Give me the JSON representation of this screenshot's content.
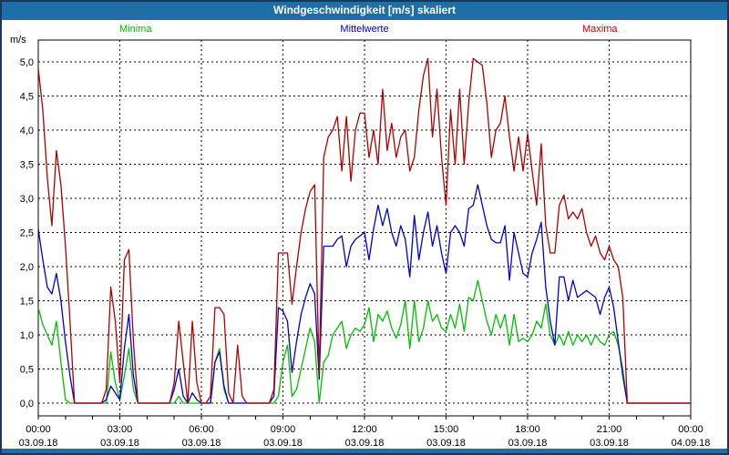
{
  "window": {
    "title": "Windgeschwindigkeit [m/s] skaliert"
  },
  "legend": {
    "minima": {
      "label": "Minima",
      "color": "#00c000"
    },
    "mittelwerte": {
      "label": "Mittelwerte",
      "color": "#0000d0"
    },
    "maxima": {
      "label": "Maxima",
      "color": "#d00000"
    }
  },
  "chart": {
    "unit_label": "m/s"
  },
  "colors": {
    "titlebar_bg": "#1e6fa5",
    "window_border": "#17375e",
    "axis": "#000000",
    "grid": "#000000",
    "background": "#ffffff"
  },
  "chart_data": {
    "type": "line",
    "title": "Windgeschwindigkeit [m/s] skaliert",
    "xlabel": "",
    "ylabel": "m/s",
    "ylim": [
      0,
      5.32
    ],
    "xlim_hours": [
      0,
      24
    ],
    "grid": "dashed",
    "legend_position": "top",
    "sample_step_minutes": 10,
    "y_ticks": [
      {
        "label": "0,0",
        "value": 0.0
      },
      {
        "label": "0,5",
        "value": 0.5
      },
      {
        "label": "1,0",
        "value": 1.0
      },
      {
        "label": "1,5",
        "value": 1.5
      },
      {
        "label": "2,0",
        "value": 2.0
      },
      {
        "label": "2,5",
        "value": 2.5
      },
      {
        "label": "3,0",
        "value": 3.0
      },
      {
        "label": "3,5",
        "value": 3.5
      },
      {
        "label": "4,0",
        "value": 4.0
      },
      {
        "label": "4,5",
        "value": 4.5
      },
      {
        "label": "5,0",
        "value": 5.0
      }
    ],
    "x_ticks": [
      {
        "time": "00:00",
        "date": "03.09.18",
        "hour": 0
      },
      {
        "time": "03:00",
        "date": "03.09.18",
        "hour": 3
      },
      {
        "time": "06:00",
        "date": "03.09.18",
        "hour": 6
      },
      {
        "time": "09:00",
        "date": "03.09.18",
        "hour": 9
      },
      {
        "time": "12:00",
        "date": "03.09.18",
        "hour": 12
      },
      {
        "time": "15:00",
        "date": "03.09.18",
        "hour": 15
      },
      {
        "time": "18:00",
        "date": "03.09.18",
        "hour": 18
      },
      {
        "time": "21:00",
        "date": "03.09.18",
        "hour": 21
      },
      {
        "time": "00:00",
        "date": "04.09.18",
        "hour": 24
      }
    ],
    "x_minor_tick_hours": 1,
    "series": [
      {
        "name": "Minima",
        "color": "#00c000",
        "values": [
          1.4,
          1.15,
          1.0,
          0.85,
          1.2,
          0.6,
          0.05,
          0,
          0,
          0,
          0,
          0,
          0,
          0,
          0,
          0,
          0.75,
          0.3,
          0.05,
          0.4,
          0.8,
          0.2,
          0,
          0,
          0,
          0,
          0,
          0,
          0,
          0,
          0,
          0.1,
          0,
          0,
          0,
          0,
          0,
          0,
          0,
          0.6,
          0.8,
          0.2,
          0,
          0,
          0,
          0,
          0,
          0,
          0,
          0,
          0,
          0,
          0,
          0.1,
          0.6,
          0.85,
          0.1,
          0.2,
          0.5,
          0.8,
          1.1,
          0.9,
          0,
          0.6,
          0.7,
          1.0,
          1.1,
          1.2,
          0.8,
          1.0,
          1.1,
          1.05,
          1.15,
          1.4,
          0.9,
          1.3,
          1.2,
          1.35,
          1.1,
          0.95,
          1.15,
          1.5,
          0.8,
          1.5,
          0.9,
          1.1,
          1.5,
          1.2,
          1.3,
          1.1,
          1.05,
          1.3,
          1.1,
          1.45,
          1.05,
          1.55,
          1.5,
          1.8,
          1.5,
          1.2,
          1.0,
          1.3,
          1.1,
          1.3,
          0.85,
          1.3,
          0.9,
          0.95,
          0.9,
          1.0,
          1.2,
          1.1,
          1.45,
          1.0,
          0.85,
          1.0,
          0.85,
          1.05,
          0.85,
          1.0,
          0.9,
          1.0,
          0.85,
          1.0,
          0.9,
          0.85,
          1.0,
          1.05,
          0.85,
          0.5,
          0,
          0,
          0,
          0,
          0,
          0,
          0,
          0,
          0,
          0,
          0,
          0,
          0,
          0,
          0
        ]
      },
      {
        "name": "Mittelwerte",
        "color": "#0000d0",
        "values": [
          2.55,
          2.1,
          1.7,
          1.6,
          1.9,
          1.5,
          0.9,
          0.4,
          0,
          0,
          0,
          0,
          0,
          0,
          0,
          0.05,
          0.25,
          0.15,
          0.05,
          0.8,
          1.3,
          0.4,
          0,
          0,
          0,
          0,
          0,
          0,
          0,
          0,
          0.2,
          0.5,
          0.1,
          0,
          0.15,
          0.05,
          0,
          0,
          0,
          0.6,
          0.75,
          0.25,
          0,
          0,
          0,
          0,
          0,
          0,
          0,
          0,
          0,
          0,
          0.1,
          1.4,
          1.35,
          1.2,
          0.45,
          0.9,
          1.3,
          1.55,
          1.75,
          1.6,
          0.35,
          2.3,
          2.3,
          2.3,
          2.4,
          2.45,
          2.0,
          2.3,
          2.4,
          2.45,
          2.5,
          2.1,
          2.55,
          2.9,
          2.6,
          2.85,
          2.5,
          2.3,
          2.6,
          2.4,
          1.85,
          2.75,
          2.1,
          2.5,
          2.8,
          2.3,
          2.6,
          2.2,
          1.9,
          2.5,
          2.6,
          2.5,
          2.3,
          2.85,
          2.9,
          3.2,
          2.9,
          2.6,
          2.4,
          2.35,
          2.35,
          2.6,
          1.8,
          2.5,
          2.2,
          1.9,
          1.85,
          2.2,
          2.4,
          2.65,
          1.7,
          1.2,
          0.85,
          1.85,
          1.85,
          1.5,
          1.8,
          1.55,
          1.6,
          1.65,
          1.6,
          1.55,
          1.3,
          1.55,
          1.7,
          1.4,
          0.9,
          0.4,
          0,
          0,
          0,
          0,
          0,
          0,
          0,
          0,
          0,
          0,
          0,
          0,
          0,
          0,
          0
        ]
      },
      {
        "name": "Maxima",
        "color": "#b00000",
        "values": [
          4.9,
          4.3,
          3.3,
          2.6,
          3.7,
          3.2,
          2.3,
          1.2,
          0,
          0,
          0,
          0,
          0,
          0,
          0,
          0.2,
          1.7,
          1.2,
          0.3,
          2.1,
          2.25,
          0.9,
          0,
          0,
          0,
          0,
          0,
          0,
          0,
          0,
          0.3,
          1.2,
          0.6,
          0,
          1.2,
          0.3,
          0,
          0,
          0.1,
          1.4,
          1.4,
          1.3,
          0.15,
          0,
          0.85,
          0.1,
          0,
          0,
          0,
          0,
          0,
          0,
          0.2,
          2.2,
          2.2,
          2.2,
          1.45,
          2.0,
          2.5,
          2.85,
          3.1,
          3.2,
          0.4,
          3.6,
          3.9,
          4.0,
          4.2,
          3.4,
          4.2,
          3.25,
          4.0,
          4.25,
          4.25,
          3.6,
          4.0,
          3.5,
          4.6,
          3.7,
          4.1,
          3.6,
          3.9,
          4.0,
          3.4,
          3.6,
          4.3,
          4.8,
          5.05,
          3.9,
          4.6,
          3.6,
          2.9,
          4.3,
          3.5,
          4.6,
          3.5,
          4.4,
          5.05,
          5.0,
          4.95,
          4.4,
          3.6,
          4.0,
          4.1,
          4.5,
          3.9,
          3.4,
          3.9,
          3.4,
          3.95,
          3.4,
          2.9,
          3.8,
          2.6,
          2.2,
          2.2,
          2.9,
          3.05,
          2.7,
          2.8,
          2.7,
          2.85,
          2.5,
          2.3,
          2.45,
          2.2,
          2.1,
          2.3,
          2.1,
          2.0,
          1.55,
          0,
          0,
          0,
          0,
          0,
          0,
          0,
          0,
          0,
          0,
          0,
          0,
          0,
          0,
          0
        ]
      }
    ]
  }
}
